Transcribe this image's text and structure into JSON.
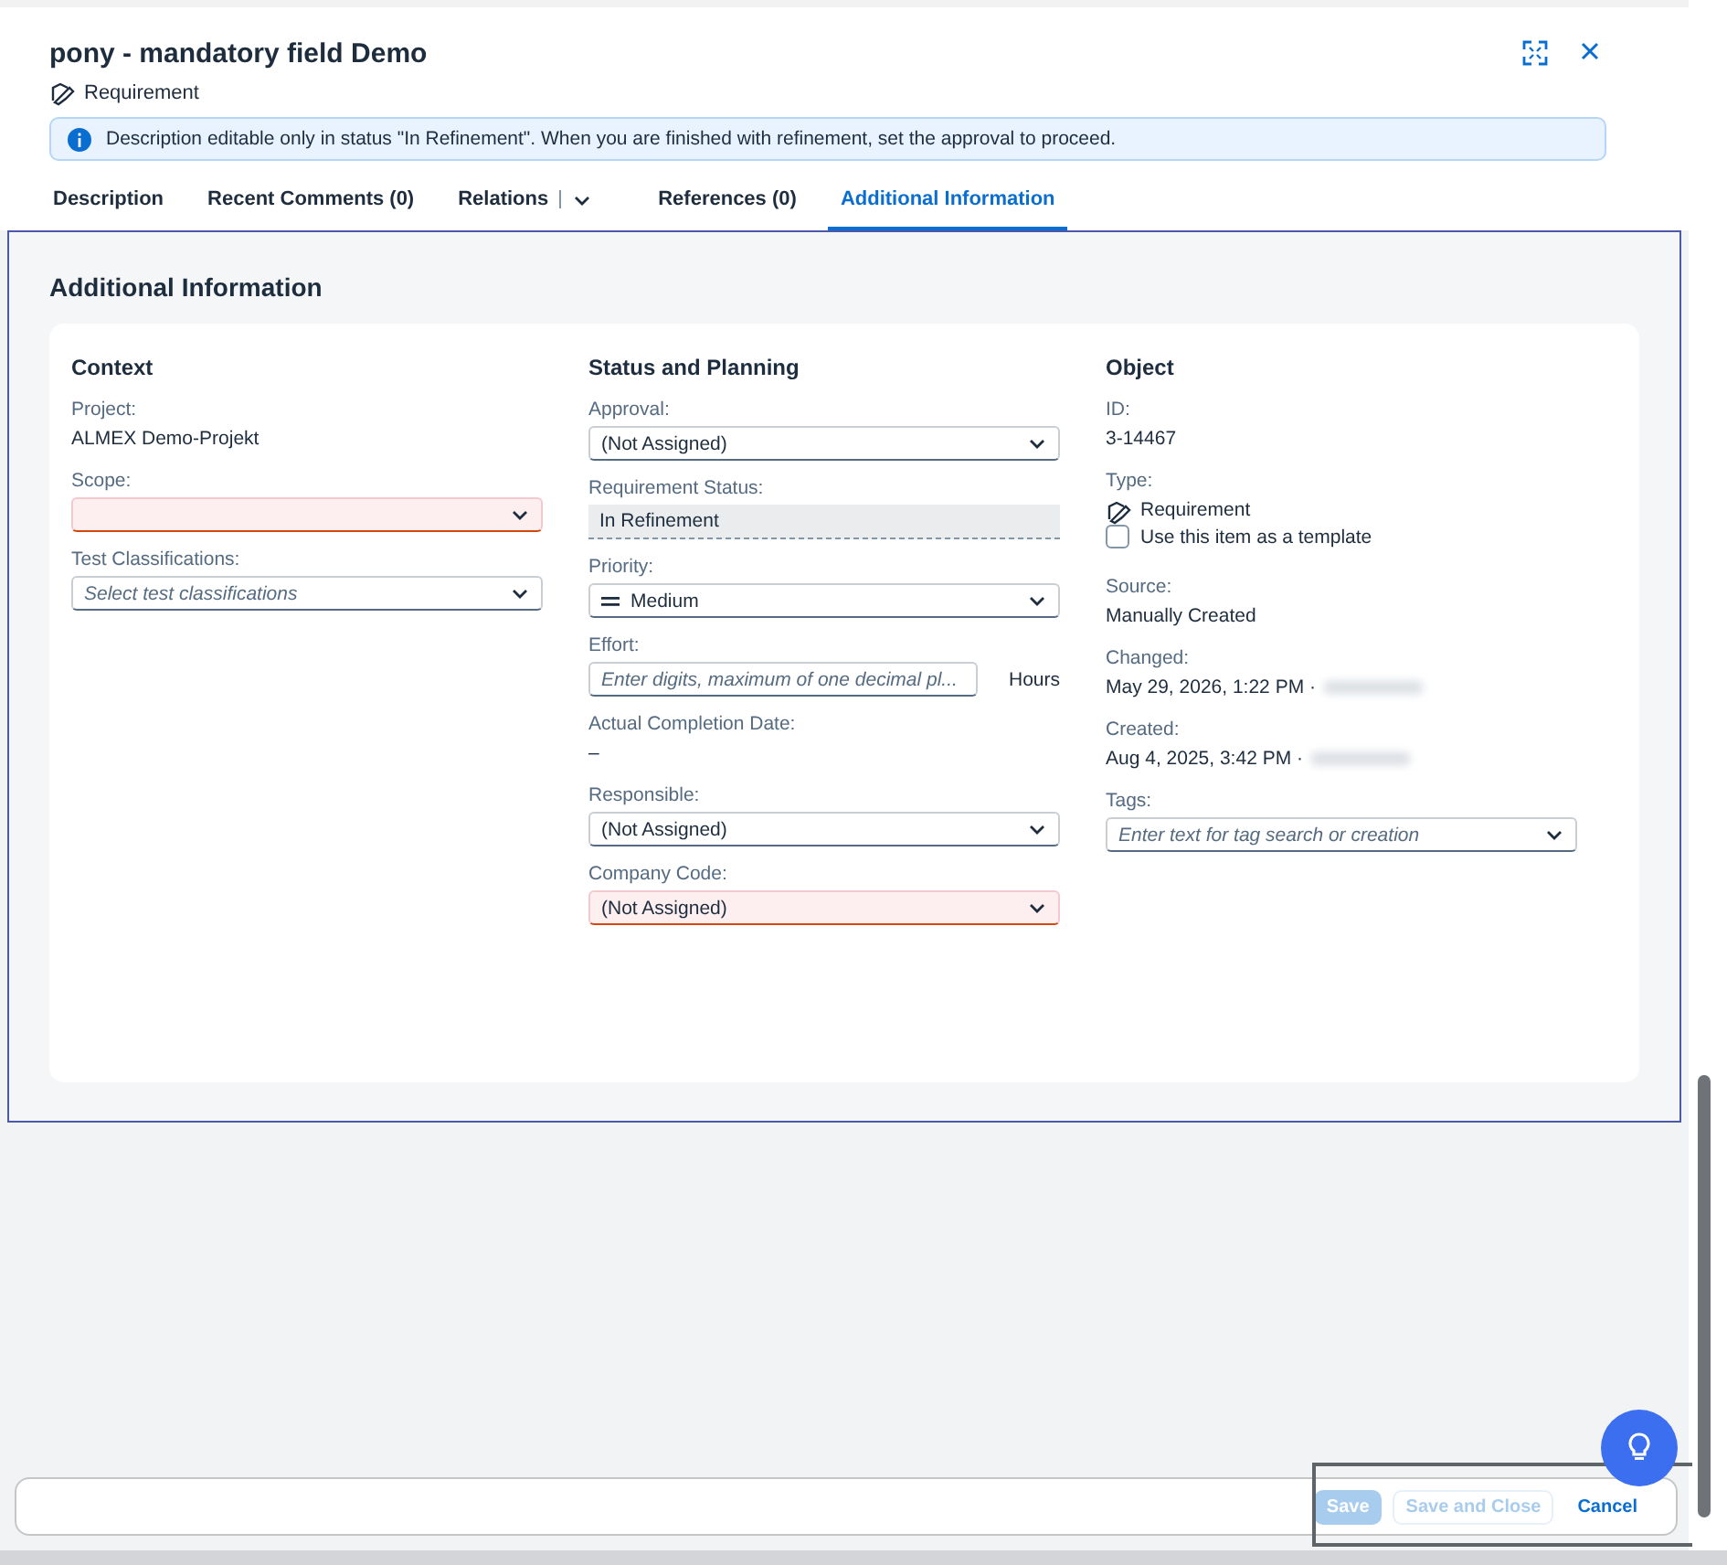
{
  "dialog": {
    "title": "pony - mandatory field Demo",
    "item_type": "Requirement"
  },
  "message_strip": {
    "text": "Description editable only in status \"In Refinement\". When you are finished with refinement, set the approval to proceed."
  },
  "tabs": [
    {
      "label": "Description",
      "selected": false,
      "has_menu": false
    },
    {
      "label": "Recent Comments (0)",
      "selected": false,
      "has_menu": false
    },
    {
      "label": "Relations",
      "selected": false,
      "has_menu": true
    },
    {
      "label": "References (0)",
      "selected": false,
      "has_menu": false
    },
    {
      "label": "Additional Information",
      "selected": true,
      "has_menu": false
    }
  ],
  "section": {
    "title": "Additional Information",
    "columns": [
      {
        "title": "Context",
        "fields": [
          {
            "kind": "text",
            "label": "Project:",
            "value": "ALMEX Demo-Projekt"
          },
          {
            "kind": "select",
            "label": "Scope:",
            "error": true
          },
          {
            "kind": "select",
            "label": "Test Classifications:",
            "placeholder": "Select test classifications",
            "error": false
          }
        ]
      },
      {
        "title": "Status and Planning",
        "fields": [
          {
            "kind": "select",
            "label": "Approval:",
            "value": "(Not Assigned)",
            "error": false
          },
          {
            "kind": "readonly",
            "label": "Requirement Status:",
            "value": "In Refinement"
          },
          {
            "kind": "priority",
            "label": "Priority:",
            "value": "Medium",
            "error": false
          },
          {
            "kind": "input",
            "label": "Effort:",
            "placeholder": "Enter digits, maximum of one decimal pl...",
            "unit": "Hours"
          },
          {
            "kind": "text",
            "label": "Actual Completion Date:",
            "value": "–"
          },
          {
            "kind": "select",
            "label": "Responsible:",
            "value": "(Not Assigned)",
            "error": false
          },
          {
            "kind": "select",
            "label": "Company Code:",
            "value": "(Not Assigned)",
            "error": true
          }
        ]
      },
      {
        "title": "Object",
        "fields": [
          {
            "kind": "text",
            "label": "ID:",
            "value": "3-14467"
          },
          {
            "kind": "type",
            "label": "Type:",
            "value": "Requirement"
          },
          {
            "kind": "checkbox",
            "label": "Use this item as a template",
            "checked": false
          },
          {
            "kind": "text",
            "label": "Source:",
            "value": "Manually Created"
          },
          {
            "kind": "text",
            "label": "Changed:",
            "value": "May 29, 2026, 1:22 PM ·",
            "redacted": true
          },
          {
            "kind": "text",
            "label": "Created:",
            "value": "Aug 4, 2025, 3:42 PM ·",
            "redacted": true
          },
          {
            "kind": "select",
            "label": "Tags:",
            "placeholder": "Enter text for tag search or creation",
            "error": false
          }
        ]
      }
    ]
  },
  "footer": {
    "buttons": [
      {
        "label": "Save",
        "kind": "emphasized",
        "disabled": true
      },
      {
        "label": "Save and Close",
        "kind": "default",
        "disabled": true
      },
      {
        "label": "Cancel",
        "kind": "transparent",
        "disabled": false
      }
    ]
  }
}
